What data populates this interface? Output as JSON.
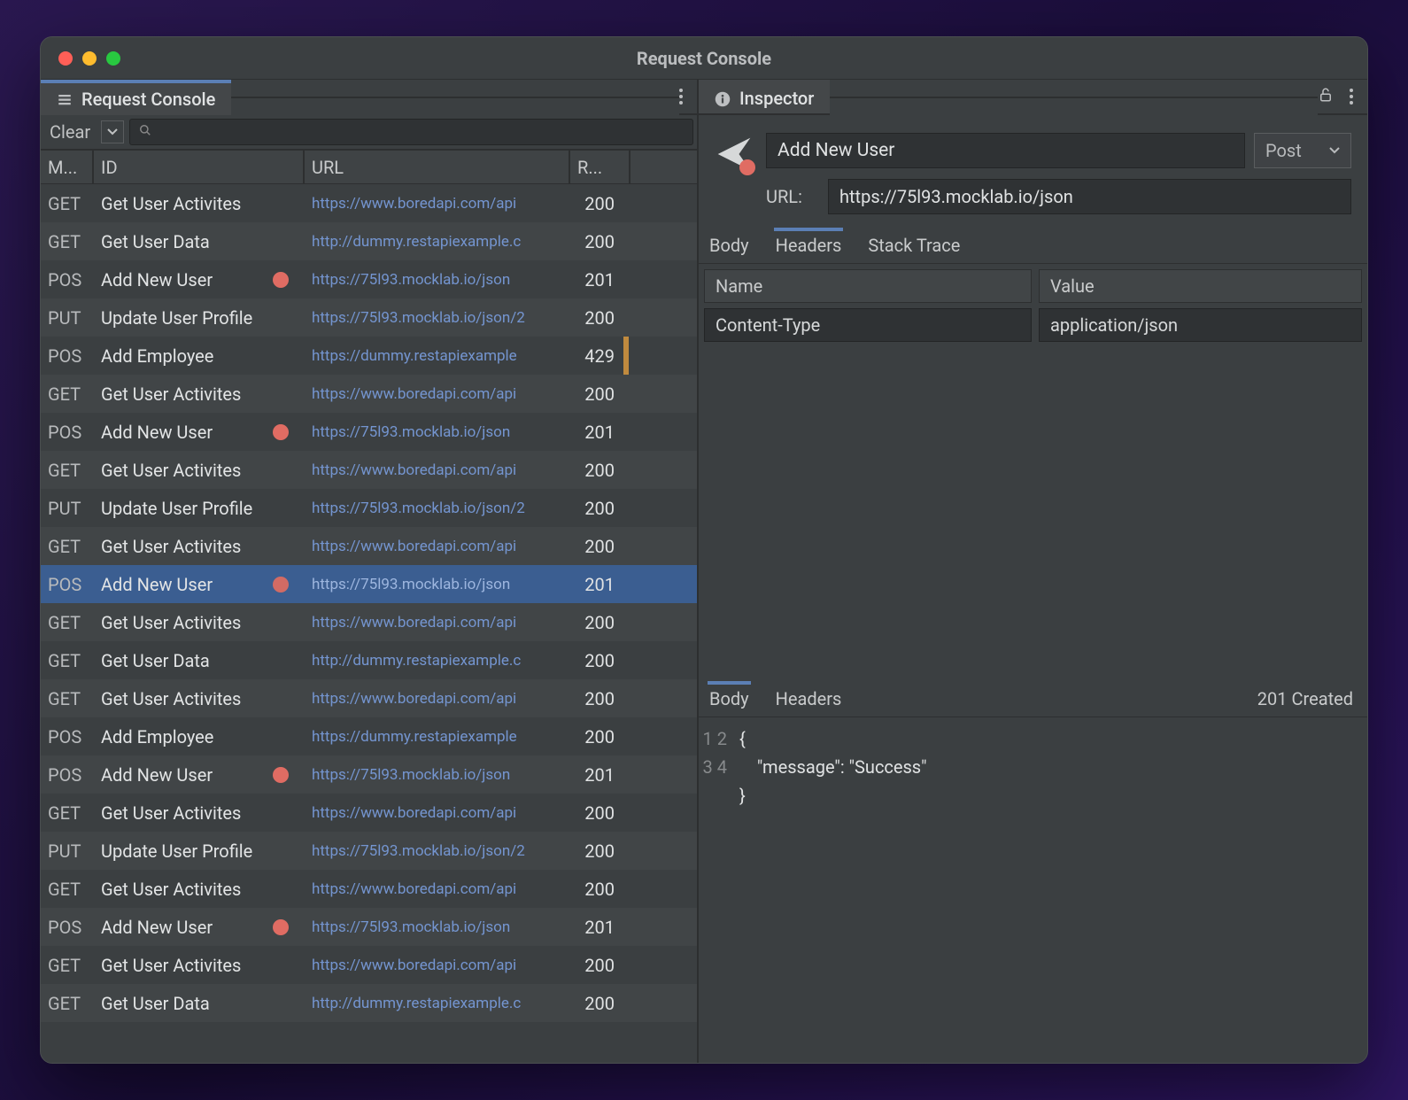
{
  "titlebar": {
    "title": "Request Console"
  },
  "leftTab": {
    "label": "Request Console"
  },
  "rightTab": {
    "label": "Inspector"
  },
  "toolbar": {
    "clear": "Clear",
    "searchPlaceholder": ""
  },
  "columns": {
    "method": "M...",
    "id": "ID",
    "url": "URL",
    "result": "R..."
  },
  "rows": [
    {
      "method": "GET",
      "id": "Get User Activites",
      "url": "https://www.boredapi.com/api",
      "result": "200",
      "dot": false,
      "warn": false
    },
    {
      "method": "GET",
      "id": "Get User Data",
      "url": "http://dummy.restapiexample.c",
      "result": "200",
      "dot": false,
      "warn": false
    },
    {
      "method": "POS",
      "id": "Add New User",
      "url": "https://75l93.mocklab.io/json",
      "result": "201",
      "dot": true,
      "warn": false
    },
    {
      "method": "PUT",
      "id": "Update User Profile",
      "url": "https://75l93.mocklab.io/json/2",
      "result": "200",
      "dot": false,
      "warn": false
    },
    {
      "method": "POS",
      "id": "Add Employee",
      "url": "https://dummy.restapiexample",
      "result": "429",
      "dot": false,
      "warn": true
    },
    {
      "method": "GET",
      "id": "Get User Activites",
      "url": "https://www.boredapi.com/api",
      "result": "200",
      "dot": false,
      "warn": false
    },
    {
      "method": "POS",
      "id": "Add New User",
      "url": "https://75l93.mocklab.io/json",
      "result": "201",
      "dot": true,
      "warn": false
    },
    {
      "method": "GET",
      "id": "Get User Activites",
      "url": "https://www.boredapi.com/api",
      "result": "200",
      "dot": false,
      "warn": false
    },
    {
      "method": "PUT",
      "id": "Update User Profile",
      "url": "https://75l93.mocklab.io/json/2",
      "result": "200",
      "dot": false,
      "warn": false
    },
    {
      "method": "GET",
      "id": "Get User Activites",
      "url": "https://www.boredapi.com/api",
      "result": "200",
      "dot": false,
      "warn": false
    },
    {
      "method": "POS",
      "id": "Add New User",
      "url": "https://75l93.mocklab.io/json",
      "result": "201",
      "dot": true,
      "warn": false,
      "selected": true
    },
    {
      "method": "GET",
      "id": "Get User Activites",
      "url": "https://www.boredapi.com/api",
      "result": "200",
      "dot": false,
      "warn": false
    },
    {
      "method": "GET",
      "id": "Get User Data",
      "url": "http://dummy.restapiexample.c",
      "result": "200",
      "dot": false,
      "warn": false
    },
    {
      "method": "GET",
      "id": "Get User Activites",
      "url": "https://www.boredapi.com/api",
      "result": "200",
      "dot": false,
      "warn": false
    },
    {
      "method": "POS",
      "id": "Add Employee",
      "url": "https://dummy.restapiexample",
      "result": "200",
      "dot": false,
      "warn": false
    },
    {
      "method": "POS",
      "id": "Add New User",
      "url": "https://75l93.mocklab.io/json",
      "result": "201",
      "dot": true,
      "warn": false
    },
    {
      "method": "GET",
      "id": "Get User Activites",
      "url": "https://www.boredapi.com/api",
      "result": "200",
      "dot": false,
      "warn": false
    },
    {
      "method": "PUT",
      "id": "Update User Profile",
      "url": "https://75l93.mocklab.io/json/2",
      "result": "200",
      "dot": false,
      "warn": false
    },
    {
      "method": "GET",
      "id": "Get User Activites",
      "url": "https://www.boredapi.com/api",
      "result": "200",
      "dot": false,
      "warn": false
    },
    {
      "method": "POS",
      "id": "Add New User",
      "url": "https://75l93.mocklab.io/json",
      "result": "201",
      "dot": true,
      "warn": false
    },
    {
      "method": "GET",
      "id": "Get User Activites",
      "url": "https://www.boredapi.com/api",
      "result": "200",
      "dot": false,
      "warn": false
    },
    {
      "method": "GET",
      "id": "Get User Data",
      "url": "http://dummy.restapiexample.c",
      "result": "200",
      "dot": false,
      "warn": false
    }
  ],
  "inspector": {
    "name": "Add New User",
    "method": "Post",
    "urlLabel": "URL:",
    "url": "https://75l93.mocklab.io/json",
    "tabs": {
      "body": "Body",
      "headers": "Headers",
      "stack": "Stack Trace"
    },
    "headerCols": {
      "name": "Name",
      "value": "Value"
    },
    "headers": [
      {
        "name": "Content-Type",
        "value": "application/json"
      }
    ],
    "response": {
      "tabs": {
        "body": "Body",
        "headers": "Headers"
      },
      "status": "201 Created",
      "lines": [
        "{",
        "    \"message\": \"Success\"",
        "}",
        ""
      ]
    }
  }
}
